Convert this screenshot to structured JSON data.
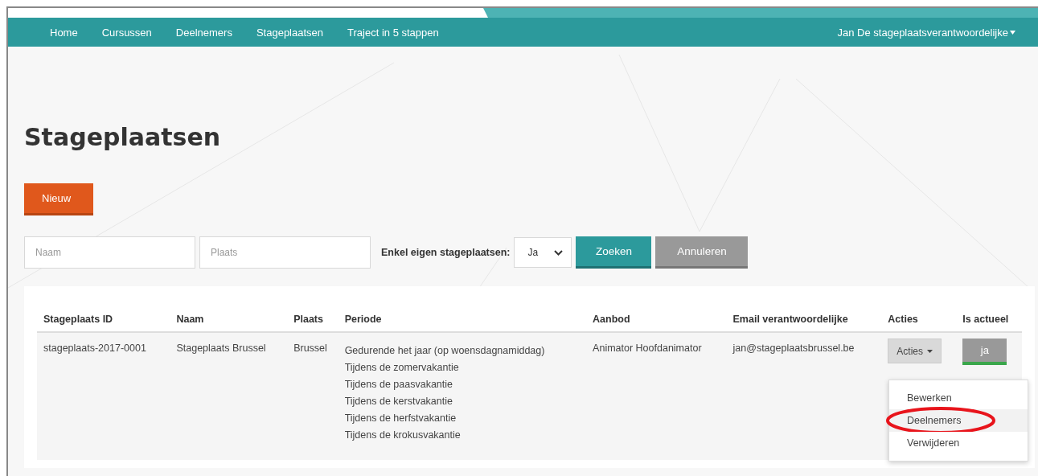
{
  "nav": {
    "items": [
      {
        "label": "Home"
      },
      {
        "label": "Cursussen"
      },
      {
        "label": "Deelnemers"
      },
      {
        "label": "Stageplaatsen"
      },
      {
        "label": "Traject in 5 stappen"
      }
    ],
    "user": "Jan De stageplaatsverantwoordelijke"
  },
  "title": "Stageplaatsen",
  "new_button": "Nieuw",
  "filters": {
    "name_placeholder": "Naam",
    "place_placeholder": "Plaats",
    "own_label": "Enkel eigen stageplaatsen:",
    "own_value": "Ja",
    "search_button": "Zoeken",
    "cancel_button": "Annuleren"
  },
  "table": {
    "columns": [
      "Stageplaats ID",
      "Naam",
      "Plaats",
      "Periode",
      "Aanbod",
      "Email verantwoordelijke",
      "Acties",
      "Is actueel"
    ],
    "rows": [
      {
        "id": "stageplaats-2017-0001",
        "name": "Stageplaats Brussel",
        "place": "Brussel",
        "periods": [
          "Gedurende het jaar (op woensdagnamiddag)",
          "Tijdens de zomervakantie",
          "Tijdens de paasvakantie",
          "Tijdens de kerstvakantie",
          "Tijdens de herfstvakantie",
          "Tijdens de krokusvakantie"
        ],
        "offer": "Animator Hoofdanimator",
        "email": "jan@stageplaatsbrussel.be",
        "actions_button": "Acties",
        "current": {
          "label": "ja",
          "on": true
        },
        "menu": [
          {
            "label": "Bewerken",
            "selected": false,
            "circled": false
          },
          {
            "label": "Deelnemers",
            "selected": true,
            "circled": true
          },
          {
            "label": "Verwijderen",
            "selected": false,
            "circled": false
          }
        ]
      }
    ]
  }
}
